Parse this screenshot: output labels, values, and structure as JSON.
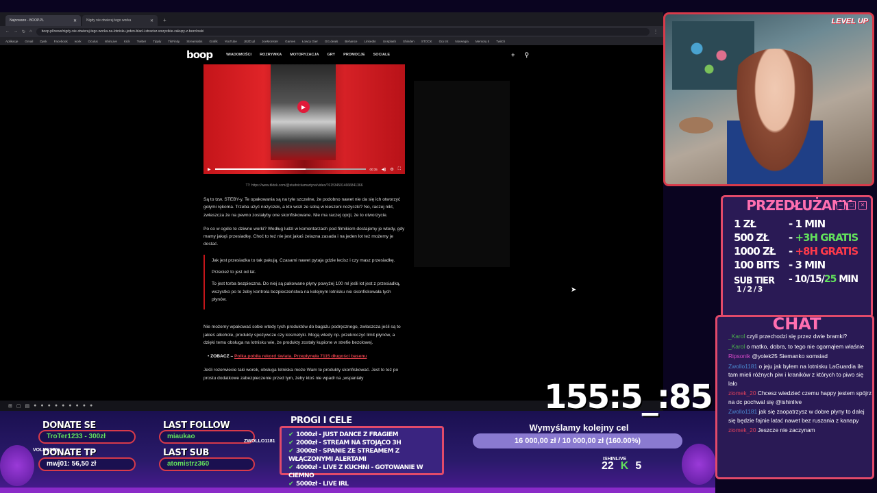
{
  "browser": {
    "tabs": [
      {
        "label": "Najnowsze - BOOP.PL",
        "active": true
      },
      {
        "label": "Nigdy nie otwieraj tego worka",
        "active": false
      }
    ],
    "url": "boop.pl/news/nigdy-nie-otwieraj-tego-worka-na-lotnisku-jeden-blad-i-stracisz-wszystkie-zakupy-z-bezclowki",
    "bookmarks": [
      "Aplikacje",
      "Gmail",
      "Dysk",
      "Facebook",
      "work",
      "Oculus",
      "IshinLive",
      "Kick",
      "Twitter",
      "Tipply",
      "TikFinity",
      "Streamlabs",
      "Grafik",
      "YouTube",
      "JBZD.pl",
      "JoeMonster",
      "Games",
      "Łowcy Gier",
      "GG.deals",
      "Behance",
      "LinkedIn",
      "Unsplash",
      "Shinden",
      "STOCK",
      "Gry tnt",
      "Norwegia",
      "Memory 5",
      "Twitch"
    ]
  },
  "site": {
    "logo": "boop",
    "nav": [
      "WIADOMOŚCI",
      "ROZRYWKA",
      "MOTORYZACJA",
      "GRY",
      "PROMOCJE",
      "SOCIALE"
    ],
    "video_time": "00:35",
    "caption": "TT: https://www.tiktok.com/@studnickamartyna/video/7615345014666841366",
    "paragraphs": [
      "Są to tzw. STEBY-y. Te opakowania są na tyle szczelne, że podobno nawet nie da się ich otworzyć gołymi rękoma. Trzeba użyć nożyczek, a kto wozi ze sobą w kieszeni nożyczki? No, raczej nikt, zwłaszcza że na pewno zostałyby one skonfiskowane. Nie ma raczej opcji, że to otworzycie.",
      "Po co w ogóle te dziwne worki? Według ludzi w komentarzach pod filmikiem dostajemy je wtedy, gdy mamy jakąś przesiadkę. Choć to też nie jest jakaś żelazna zasada i na jeden lot też możemy je dostać."
    ],
    "quote": [
      "Jak jest przesiadka to tak pakują. Czasami nawet pytaja gdzie lecisz i czy masz przesiadkę.",
      "Przecież to jest od lat.",
      "To jest torba bezpieczna. Do niej są pakowane płyny powyżej 100 ml jeśli lot jest z przesiadką, wszystko po to żeby kontrola bezpieczeństwa na kolejnym lotnisku nie skonfiskowała tych płynów."
    ],
    "paragraph3": "Nie możemy wpakować sobie wtedy tych produktów do bagażu podręcznego, zwłaszcza jeśli są to jakieś alkohole, produkty spożywcze czy kosmetyki. Mogą wtedy np. przekroczyć limit płynów, a dzięki temu obsługa na lotnisku wie, że produkty zostały kupione w strefie bezcłowej.",
    "zobacz_label": "ZOBACZ –",
    "zobacz_link": "Polka pobiła rekord świata. Przepłynęła 7115 długości basenu",
    "paragraph4": "Jeśli rozerwiecie taki worek, obsługa lotniska może Wam te produkty skonfiskować. Jest to też po prostu dodatkowe zabezpieczenie przed tym, żeby ktoś nie wpadł na „wspaniały"
  },
  "overlay": {
    "levelup": "LEVEL UP",
    "extension_title": "PRZEDŁUŻANY",
    "extension_rows": [
      {
        "left": "1 ZŁ",
        "right": "- 1 MIN",
        "extra": "",
        "extra_color": ""
      },
      {
        "left": "500 ZŁ",
        "right": "- ",
        "extra": "+3H GRATIS",
        "extra_color": "#62e05c"
      },
      {
        "left": "1000 ZŁ",
        "right": "- ",
        "extra": "+8H GRATIS",
        "extra_color": "#ff3a4a"
      },
      {
        "left": "100 BITS",
        "right": "- 3 MIN",
        "extra": "",
        "extra_color": ""
      },
      {
        "left": "SUB TIER",
        "right": "- 10/15/",
        "extra": "25",
        "extra_color": "#62e05c",
        "suffix": " MIN"
      }
    ],
    "sub_tiers": "1 / 2 / 3",
    "chat_title": "CHAT",
    "chat": [
      {
        "user": "",
        "text": "",
        "cls": ""
      },
      {
        "user": "_Karol",
        "text": "czyli przechodzi się przez dwie bramki?",
        "cls": ""
      },
      {
        "user": "_Karol",
        "text": "o matko, dobra, to tego nie ogarnąłem właśnie",
        "cls": ""
      },
      {
        "user": "Ripsonik",
        "text": "@yolek25 Siemanko somsiad",
        "cls": "p"
      },
      {
        "user": "Zwollo1181",
        "text": "o jeju jak byłem na lotnisku LaGuardia ile tam mieli różnych piw i kraników z których to piwo się lało",
        "cls": "b"
      },
      {
        "user": "ziomek_20",
        "text": "Chcesz wiedzieć czemu happy jestem spójrz na dc pochwal się @ishinlive",
        "cls": "r"
      },
      {
        "user": "Zwollo1181",
        "text": "jak się zaopatrzysz w dobre płyny to dalej się będzie fajnie latać nawet bez ruszania z kanapy",
        "cls": "b"
      },
      {
        "user": "ziomek_20",
        "text": "Jeszcze nie zaczynam",
        "cls": "r"
      }
    ],
    "timer": "155:5_:85",
    "donate_label": "DONATE SE",
    "donate_value": "TroTer1233 - 300zł",
    "donate_tp_label": "DONATE TP",
    "donate_tp_value": "mwj01: 56,50 zł",
    "last_follow_label": "LAST FOLLOW",
    "last_follow_value": "miaukao",
    "last_sub_label": "LAST SUB",
    "last_sub_value": "atomistrz360",
    "name_tag": "ZWOLLO1181",
    "name_tag2": "ISHINLIVE",
    "name_tag3": "VOLKES25",
    "goals_title": "PROGI I CELE",
    "goals": [
      "1000zł - JUST DANCE Z FRAGIEM",
      "2000zł - STREAM NA STOJĄCO 3H",
      "3000zł - SPANIE ZE STREAMEM Z WŁĄCZONYMI ALERTAMI",
      "4000zł - LIVE Z KUCHNI - GOTOWANIE W CIEMNO",
      "5000zł - LIVE IRL"
    ],
    "target_title": "Wymyślamy kolejny cel",
    "target_text": "16 000,00 zł / 10 000,00 zł (160.00%)",
    "target_progress": 1.0,
    "count_a": "22",
    "count_b": "5",
    "count_b_label": "K"
  }
}
